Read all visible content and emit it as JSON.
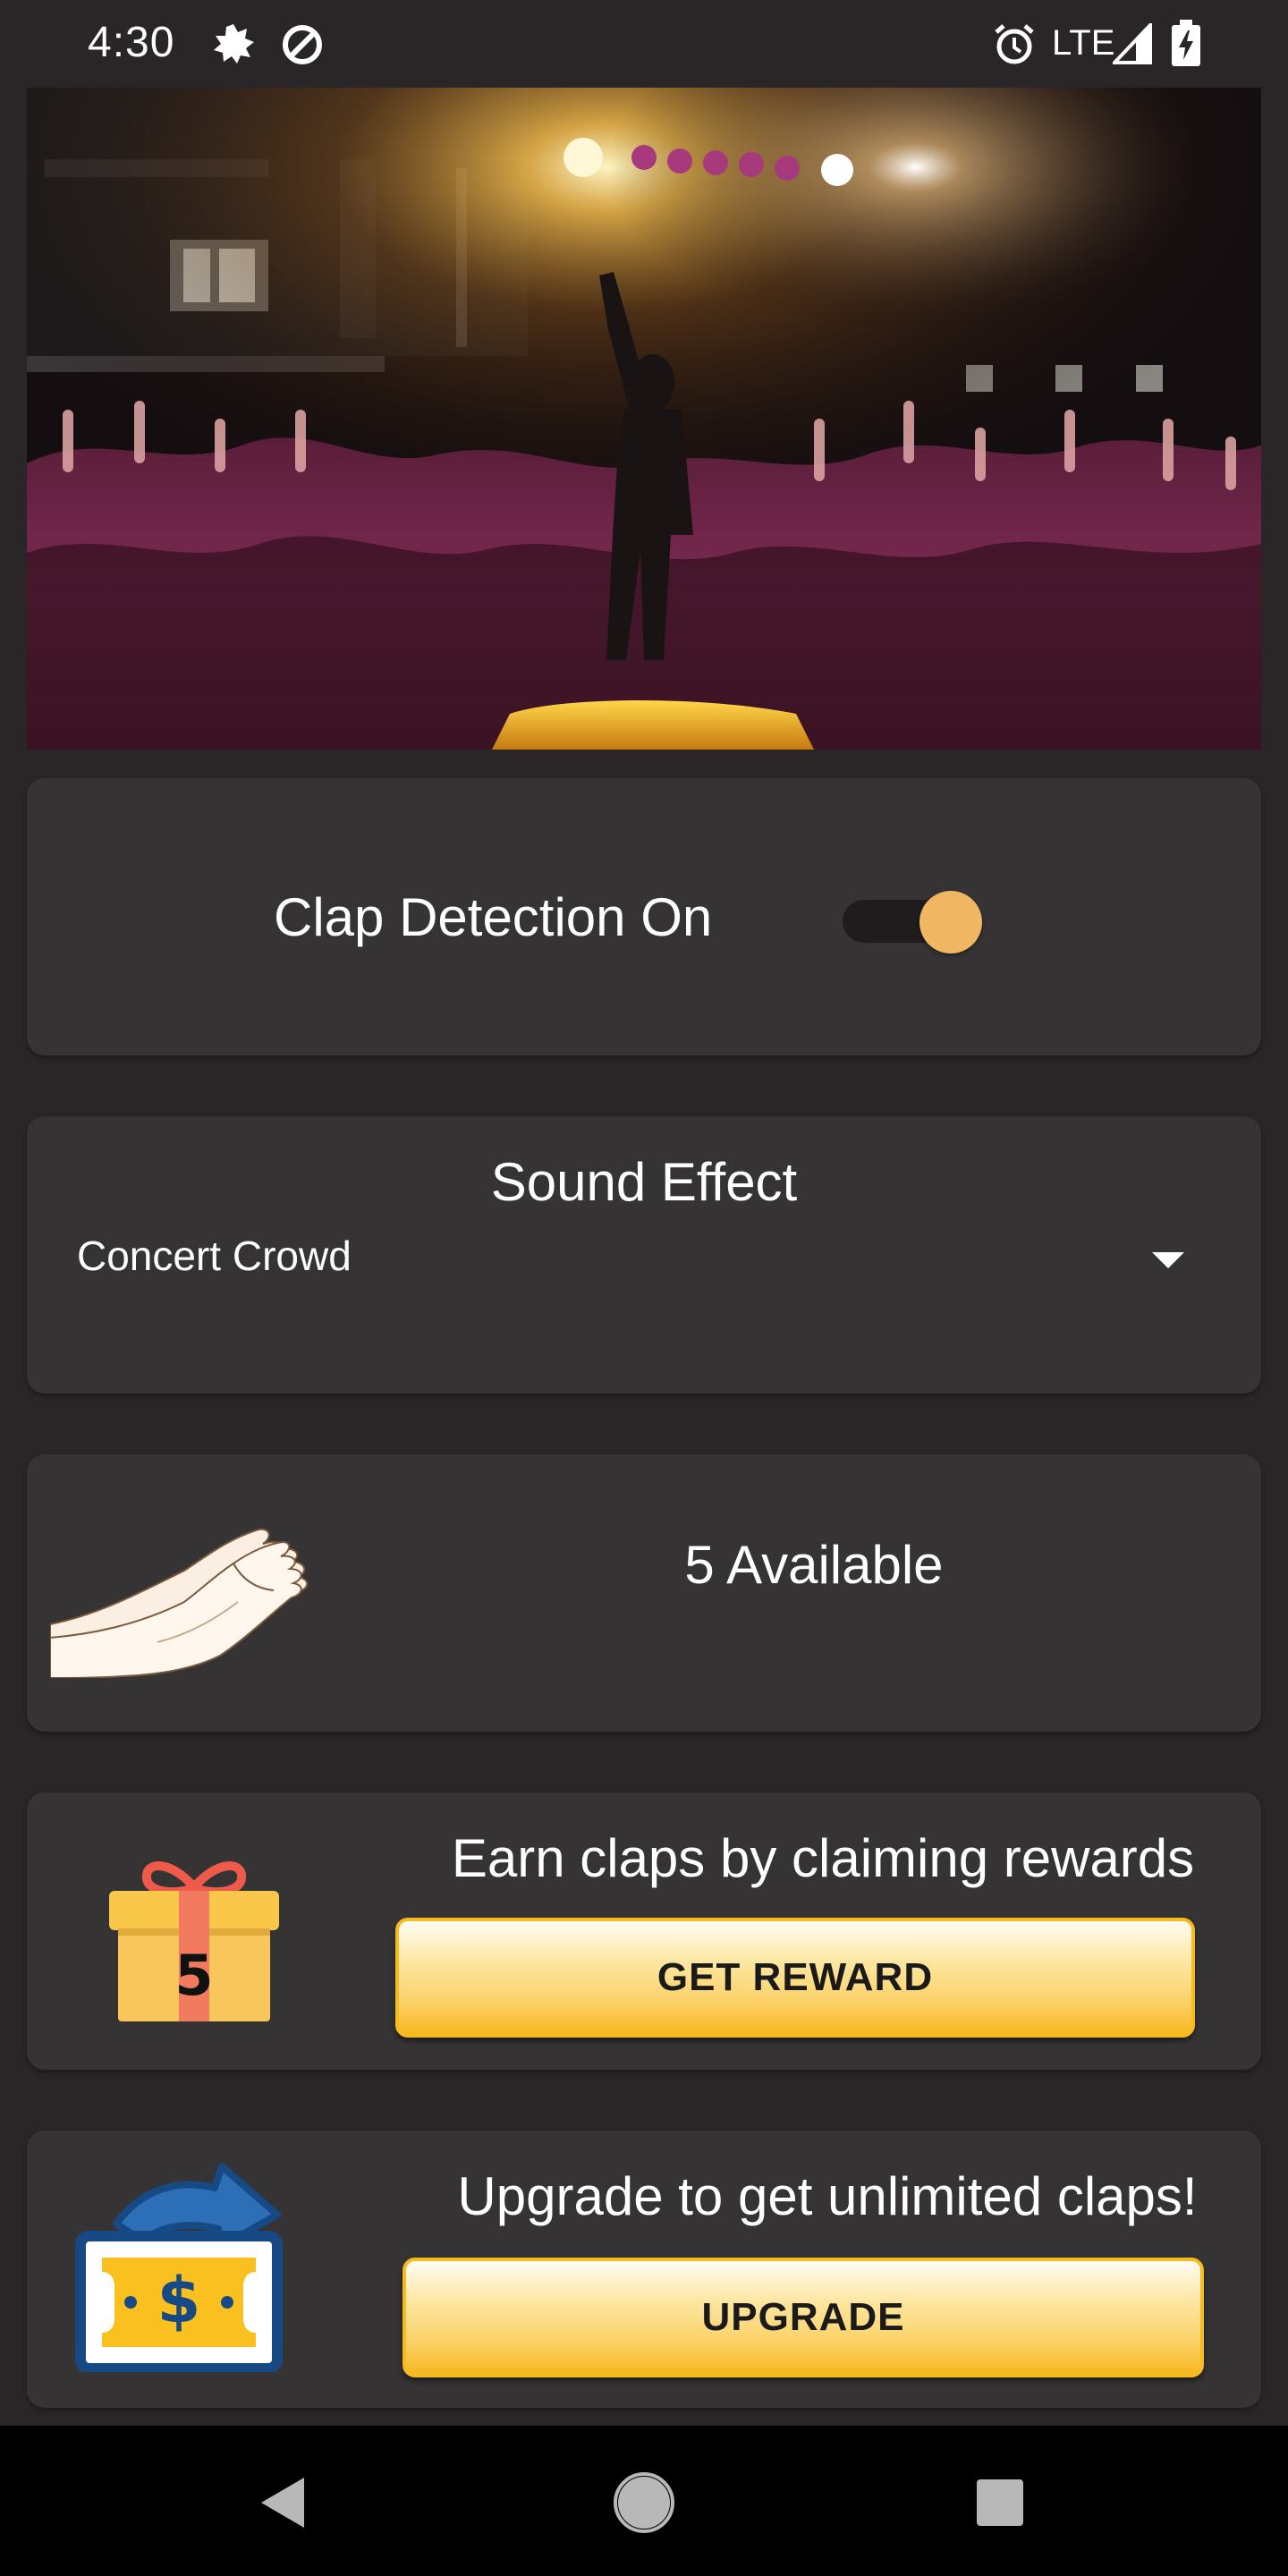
{
  "status_bar": {
    "time": "4:30",
    "network_label": "LTE",
    "icons": [
      "notification-burst-icon",
      "data-saver-icon",
      "alarm-icon",
      "signal-icon",
      "battery-charging-icon"
    ]
  },
  "hero": {
    "image": "concert-photo"
  },
  "clap_detection": {
    "label": "Clap Detection On",
    "enabled": true,
    "accent_color": "#f0b662"
  },
  "sound_effect": {
    "title": "Sound Effect",
    "selected": "Concert Crowd"
  },
  "claps": {
    "icon": "clapping-hands-icon",
    "available_label": "5 Available"
  },
  "reward": {
    "icon": "gift-box-icon",
    "gift_number": "5",
    "text": "Earn claps by claiming rewards",
    "button_label": "GET REWARD"
  },
  "upgrade": {
    "icon": "money-upgrade-icon",
    "text": "Upgrade to get unlimited claps!",
    "button_label": "UPGRADE"
  },
  "colors": {
    "background": "#2a2627",
    "card": "#353334",
    "button_gold": "#f7ba1f"
  },
  "nav": {
    "buttons": [
      "back-icon",
      "home-icon",
      "recents-icon"
    ]
  }
}
